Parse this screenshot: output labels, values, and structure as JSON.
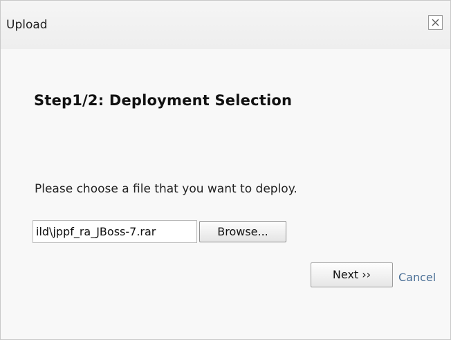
{
  "window": {
    "title": "Upload",
    "close_icon": "close-icon"
  },
  "step": {
    "title": "Step1/2: Deployment Selection"
  },
  "form": {
    "instruction": "Please choose a file that you want to deploy.",
    "file_value": "ild\\jppf_ra_JBoss-7.rar",
    "browse_label": "Browse..."
  },
  "actions": {
    "next_label": "Next ››",
    "cancel_label": "Cancel"
  },
  "colors": {
    "title_bar": "#f0f0f0",
    "content_background": "#f8f8f8",
    "cancel_link": "#4a6f96"
  }
}
